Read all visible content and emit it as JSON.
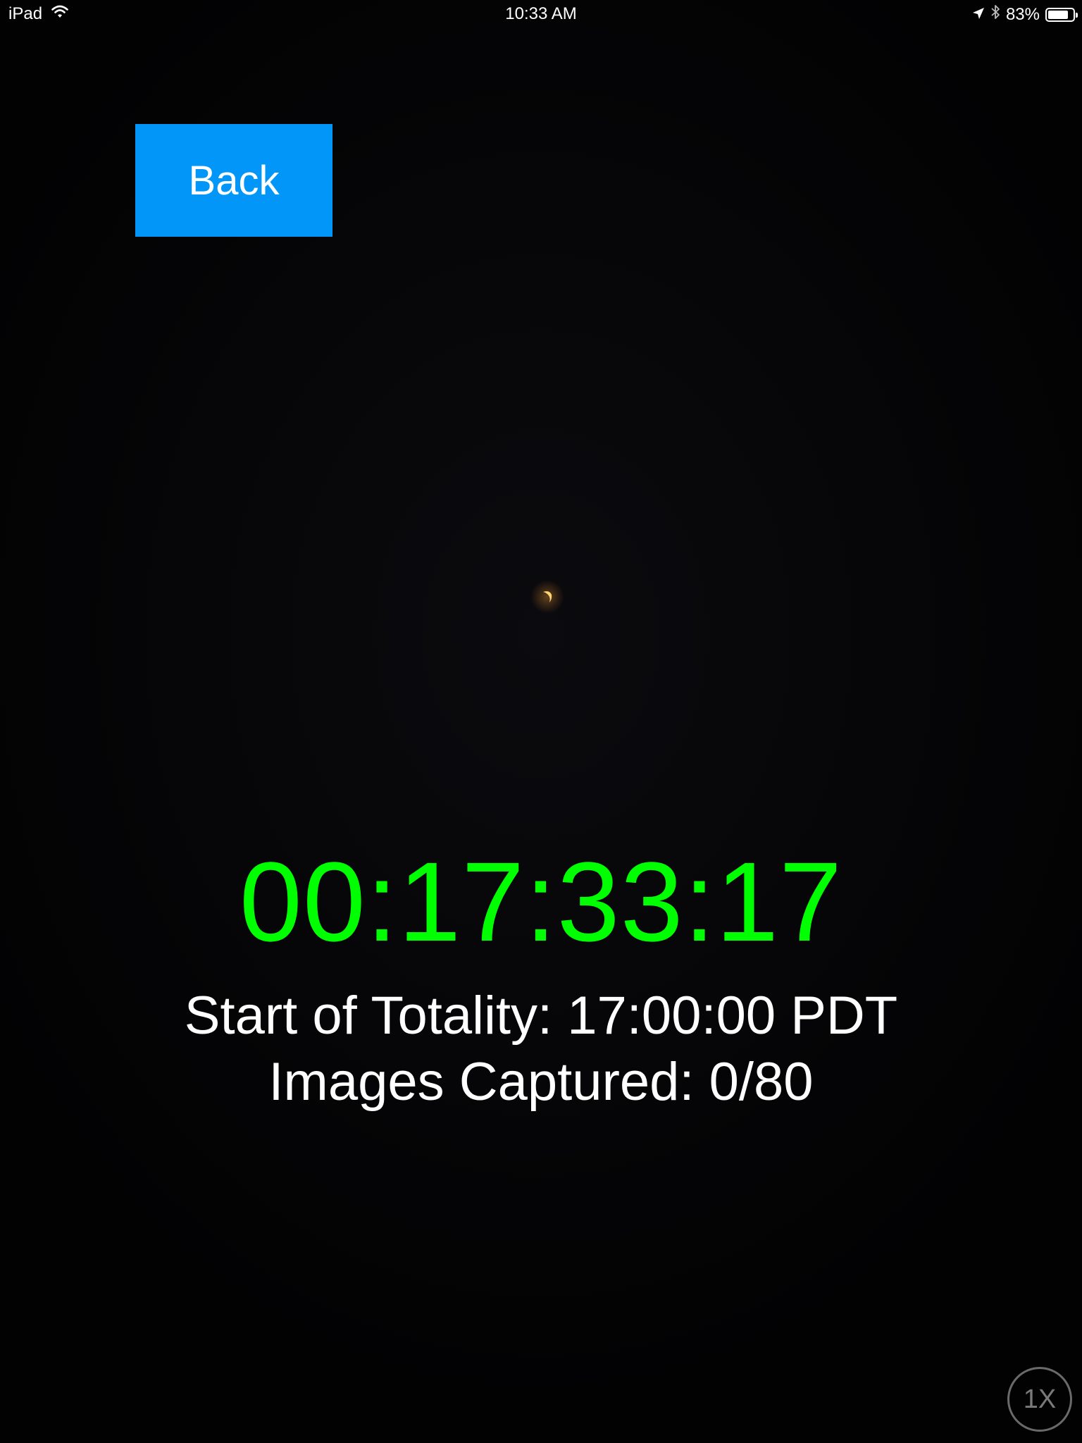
{
  "status_bar": {
    "device": "iPad",
    "time": "10:33 AM",
    "battery_percent": "83%",
    "battery_level": 0.83,
    "icons": [
      "wifi-icon",
      "location-arrow-icon",
      "bluetooth-icon",
      "battery-icon"
    ]
  },
  "back_button": {
    "label": "Back",
    "color": "#0196f8"
  },
  "countdown": {
    "value": "00:17:33:17",
    "color": "#00ff00"
  },
  "info": {
    "totality": "Start of Totality: 17:00:00 PDT",
    "images": "Images Captured: 0/80"
  },
  "zoom": {
    "label": "1X"
  }
}
